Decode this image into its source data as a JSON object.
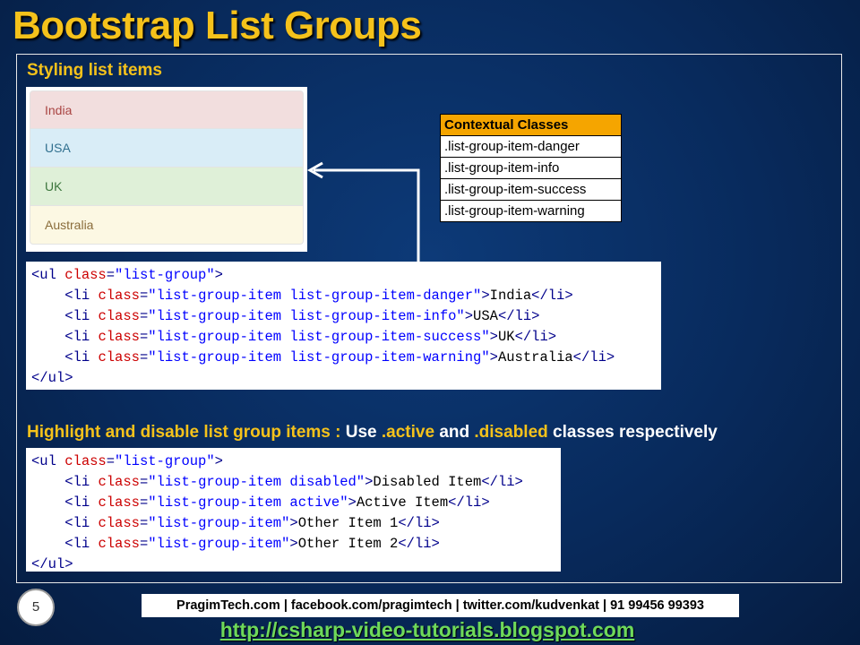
{
  "slide": {
    "title": "Bootstrap List Groups",
    "page_number": "5"
  },
  "section1": {
    "heading": "Styling list items",
    "demo_items": [
      "India",
      "USA",
      "UK",
      "Australia"
    ]
  },
  "contextual_table": {
    "header": "Contextual Classes",
    "rows": [
      ".list-group-item-danger",
      ".list-group-item-info",
      ".list-group-item-success",
      ".list-group-item-warning"
    ]
  },
  "code1": {
    "lines": [
      [
        [
          "tag",
          "<ul "
        ],
        [
          "attr",
          "class"
        ],
        [
          "tag",
          "="
        ],
        [
          "val",
          "\"list-group\""
        ],
        [
          "tag",
          ">"
        ]
      ],
      [
        [
          "txt",
          "    "
        ],
        [
          "tag",
          "<li "
        ],
        [
          "attr",
          "class"
        ],
        [
          "tag",
          "="
        ],
        [
          "val",
          "\"list-group-item list-group-item-danger\""
        ],
        [
          "tag",
          ">"
        ],
        [
          "txt",
          "India"
        ],
        [
          "tag",
          "</li>"
        ]
      ],
      [
        [
          "txt",
          "    "
        ],
        [
          "tag",
          "<li "
        ],
        [
          "attr",
          "class"
        ],
        [
          "tag",
          "="
        ],
        [
          "val",
          "\"list-group-item list-group-item-info\""
        ],
        [
          "tag",
          ">"
        ],
        [
          "txt",
          "USA"
        ],
        [
          "tag",
          "</li>"
        ]
      ],
      [
        [
          "txt",
          "    "
        ],
        [
          "tag",
          "<li "
        ],
        [
          "attr",
          "class"
        ],
        [
          "tag",
          "="
        ],
        [
          "val",
          "\"list-group-item list-group-item-success\""
        ],
        [
          "tag",
          ">"
        ],
        [
          "txt",
          "UK"
        ],
        [
          "tag",
          "</li>"
        ]
      ],
      [
        [
          "txt",
          "    "
        ],
        [
          "tag",
          "<li "
        ],
        [
          "attr",
          "class"
        ],
        [
          "tag",
          "="
        ],
        [
          "val",
          "\"list-group-item list-group-item-warning\""
        ],
        [
          "tag",
          ">"
        ],
        [
          "txt",
          "Australia"
        ],
        [
          "tag",
          "</li>"
        ]
      ],
      [
        [
          "tag",
          "</ul>"
        ]
      ]
    ]
  },
  "section2": {
    "heading_part1": "Highlight and disable list group items : ",
    "heading_part2": "Use ",
    "heading_part3": ".active",
    "heading_part4": " and ",
    "heading_part5": ".disabled",
    "heading_part6": " classes respectively"
  },
  "code2": {
    "lines": [
      [
        [
          "tag",
          "<ul "
        ],
        [
          "attr",
          "class"
        ],
        [
          "tag",
          "="
        ],
        [
          "val",
          "\"list-group\""
        ],
        [
          "tag",
          ">"
        ]
      ],
      [
        [
          "txt",
          "    "
        ],
        [
          "tag",
          "<li "
        ],
        [
          "attr",
          "class"
        ],
        [
          "tag",
          "="
        ],
        [
          "val",
          "\"list-group-item disabled\""
        ],
        [
          "tag",
          ">"
        ],
        [
          "txt",
          "Disabled Item"
        ],
        [
          "tag",
          "</li>"
        ]
      ],
      [
        [
          "txt",
          "    "
        ],
        [
          "tag",
          "<li "
        ],
        [
          "attr",
          "class"
        ],
        [
          "tag",
          "="
        ],
        [
          "val",
          "\"list-group-item active\""
        ],
        [
          "tag",
          ">"
        ],
        [
          "txt",
          "Active Item"
        ],
        [
          "tag",
          "</li>"
        ]
      ],
      [
        [
          "txt",
          "    "
        ],
        [
          "tag",
          "<li "
        ],
        [
          "attr",
          "class"
        ],
        [
          "tag",
          "="
        ],
        [
          "val",
          "\"list-group-item\""
        ],
        [
          "tag",
          ">"
        ],
        [
          "txt",
          "Other Item 1"
        ],
        [
          "tag",
          "</li>"
        ]
      ],
      [
        [
          "txt",
          "    "
        ],
        [
          "tag",
          "<li "
        ],
        [
          "attr",
          "class"
        ],
        [
          "tag",
          "="
        ],
        [
          "val",
          "\"list-group-item\""
        ],
        [
          "tag",
          ">"
        ],
        [
          "txt",
          "Other Item 2"
        ],
        [
          "tag",
          "</li>"
        ]
      ],
      [
        [
          "tag",
          "</ul>"
        ]
      ]
    ]
  },
  "footer": {
    "contact": "PragimTech.com | facebook.com/pragimtech  | twitter.com/kudvenkat  | 91 99456 99393",
    "url": "http://csharp-video-tutorials.blogspot.com"
  },
  "colors": {
    "title": "#f5c21b",
    "heading": "#f5c21b",
    "table_header": "#f5a500",
    "url": "#6ed95a",
    "danger_bg": "#f2dede",
    "info_bg": "#d9edf7",
    "success_bg": "#dff0d8",
    "warning_bg": "#fcf8e3"
  }
}
